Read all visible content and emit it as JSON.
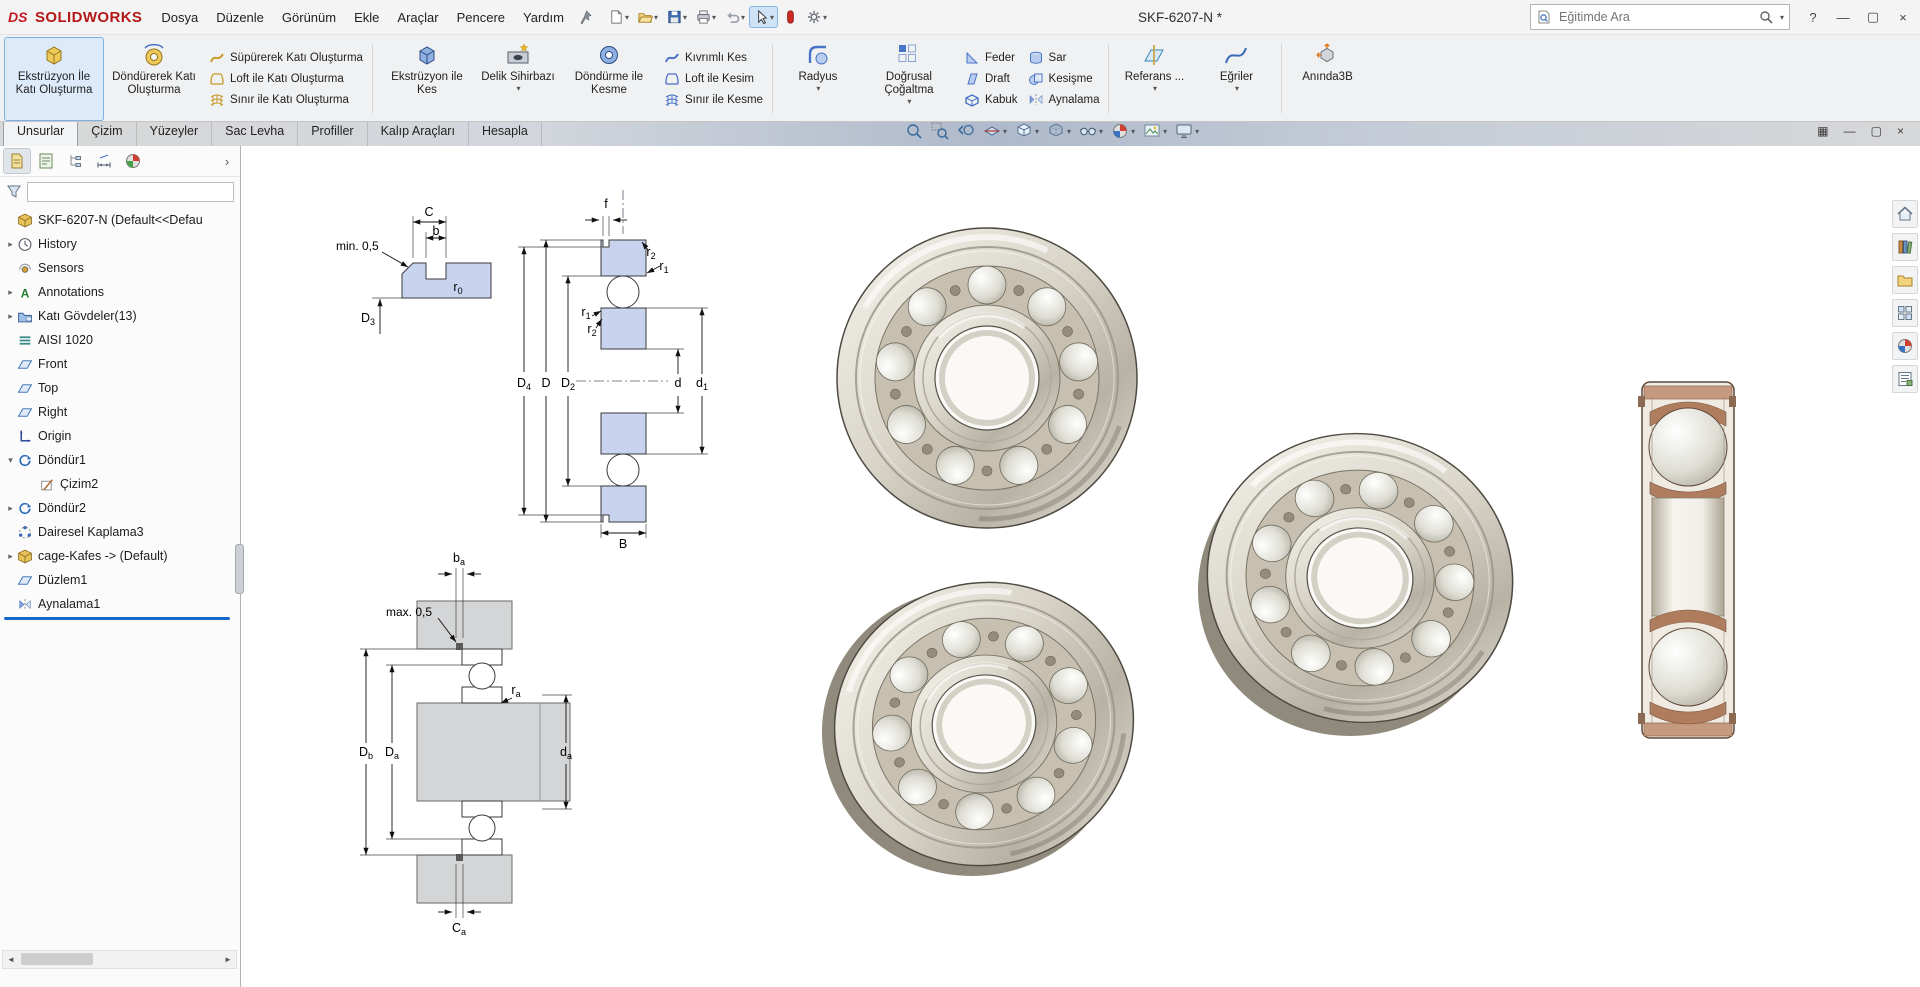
{
  "window": {
    "brand": "SOLIDWORKS",
    "title": "SKF-6207-N *",
    "help_glyph": "?",
    "min_glyph": "—",
    "max_glyph": "▢",
    "close_glyph": "×"
  },
  "menubar": {
    "items": [
      "Dosya",
      "Düzenle",
      "Görünüm",
      "Ekle",
      "Araçlar",
      "Pencere",
      "Yardım"
    ]
  },
  "search": {
    "placeholder": "Eğitimde Ara"
  },
  "glyphs": {
    "collapsed": "▸",
    "expanded": "▾",
    "chevron": "›",
    "dd": "▾",
    "left": "◄",
    "right": "►"
  },
  "ribbon": {
    "extrude_boss": "Ekstrüzyon İle Katı Oluşturma",
    "revolve_boss": "Döndürerek Katı Oluşturma",
    "sweep_boss": "Süpürerek Katı Oluşturma",
    "loft_boss": "Loft ile Katı Oluşturma",
    "boundary_boss": "Sınır ile Katı Oluşturma",
    "extrude_cut": "Ekstrüzyon ile Kes",
    "hole_wizard": "Delik Sihirbazı",
    "revolve_cut": "Döndürme ile Kesme",
    "swept_cut": "Kıvrımlı Kes",
    "loft_cut": "Loft ile Kesim",
    "boundary_cut": "Sınır ile Kesme",
    "fillet": "Radyus",
    "linear_pattern": "Doğrusal Çoğaltma",
    "rib": "Feder",
    "draft": "Draft",
    "shell": "Kabuk",
    "wrap": "Sar",
    "intersect": "Kesişme",
    "mirror": "Aynalama",
    "reference": "Referans ...",
    "curves": "Eğriler",
    "instant3d": "Anında3B"
  },
  "tabs": {
    "items": [
      "Unsurlar",
      "Çizim",
      "Yüzeyler",
      "Sac Levha",
      "Profiller",
      "Kalıp Araçları",
      "Hesapla"
    ]
  },
  "docbar": {
    "tile": "▦",
    "min": "—",
    "restore": "▢",
    "close": "×"
  },
  "tree": {
    "root": "SKF-6207-N  (Default<<Defau",
    "items": [
      {
        "label": "History"
      },
      {
        "label": "Sensors"
      },
      {
        "label": "Annotations"
      },
      {
        "label": "Katı Gövdeler(13)"
      },
      {
        "label": "AISI 1020"
      },
      {
        "label": "Front"
      },
      {
        "label": "Top"
      },
      {
        "label": "Right"
      },
      {
        "label": "Origin"
      },
      {
        "label": "Döndür1"
      },
      {
        "label": "Çizim2"
      },
      {
        "label": "Döndür2"
      },
      {
        "label": "Dairesel Kaplama3"
      },
      {
        "label": "cage-Kafes -> (Default)"
      },
      {
        "label": "Düzlem1"
      },
      {
        "label": "Aynalama1"
      }
    ]
  },
  "dims": {
    "C": [
      "C",
      ""
    ],
    "b": [
      "b",
      ""
    ],
    "min05": [
      "min. 0,5",
      ""
    ],
    "D3": [
      "D",
      "3"
    ],
    "r0": [
      "r",
      "0"
    ],
    "f": [
      "f",
      ""
    ],
    "r1": [
      "r",
      "1"
    ],
    "r2": [
      "r",
      "2"
    ],
    "D4": [
      "D",
      "4"
    ],
    "D": [
      "D",
      ""
    ],
    "D2": [
      "D",
      "2"
    ],
    "d": [
      "d",
      ""
    ],
    "d1": [
      "d",
      "1"
    ],
    "B": [
      "B",
      ""
    ],
    "ba": [
      "b",
      "a"
    ],
    "max05": [
      "max. 0,5",
      ""
    ],
    "ra": [
      "r",
      "a"
    ],
    "Db": [
      "D",
      "b"
    ],
    "Da": [
      "D",
      "a"
    ],
    "da": [
      "d",
      "a"
    ],
    "Ca": [
      "C",
      "a"
    ]
  }
}
